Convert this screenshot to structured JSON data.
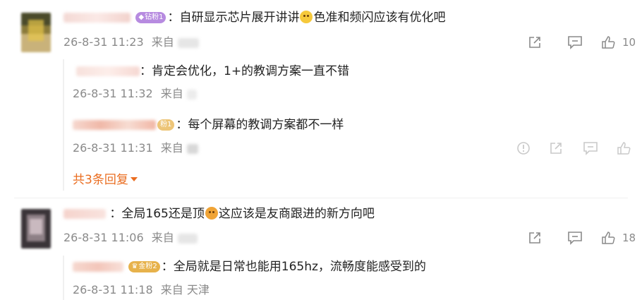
{
  "comments": [
    {
      "badge": "钻粉1",
      "text_a": "：自研显示芯片展开讲讲",
      "text_b": "色准和频闪应该有优化吧",
      "time": "26-8-31 11:23",
      "from_label": "来自",
      "location": "",
      "likes": "10",
      "replies": [
        {
          "text": "：肯定会优化，1+的教调方案一直不错",
          "time": "26-8-31 11:32",
          "from_label": "来自",
          "location": ""
        },
        {
          "badge": "粉1",
          "text": "：每个屏幕的教调方案都不一样",
          "time": "26-8-31 11:31",
          "from_label": "来自",
          "location": ""
        }
      ],
      "more_replies": "共3条回复"
    },
    {
      "text_a": "：全局165还是顶",
      "text_b": "这应该是友商跟进的新方向吧",
      "time": "26-8-31 11:06",
      "from_label": "来自",
      "location": "",
      "likes": "18",
      "replies": [
        {
          "badge": "金粉2",
          "text": "：全局就是日常也能用165hz，流畅度能感受到的",
          "time": "26-8-31 11:18",
          "from_label": "来自",
          "location": "天津"
        }
      ]
    }
  ],
  "icons": {
    "share": "share-icon",
    "comment": "comment-icon",
    "like": "like-icon",
    "report": "report-icon",
    "emoji": "emoji-face-icon"
  },
  "colors": {
    "accent": "#ea6d20",
    "meta_text": "#8a8a8a",
    "badge_purple": "#b78be0",
    "badge_gold": "#e7b24b"
  }
}
